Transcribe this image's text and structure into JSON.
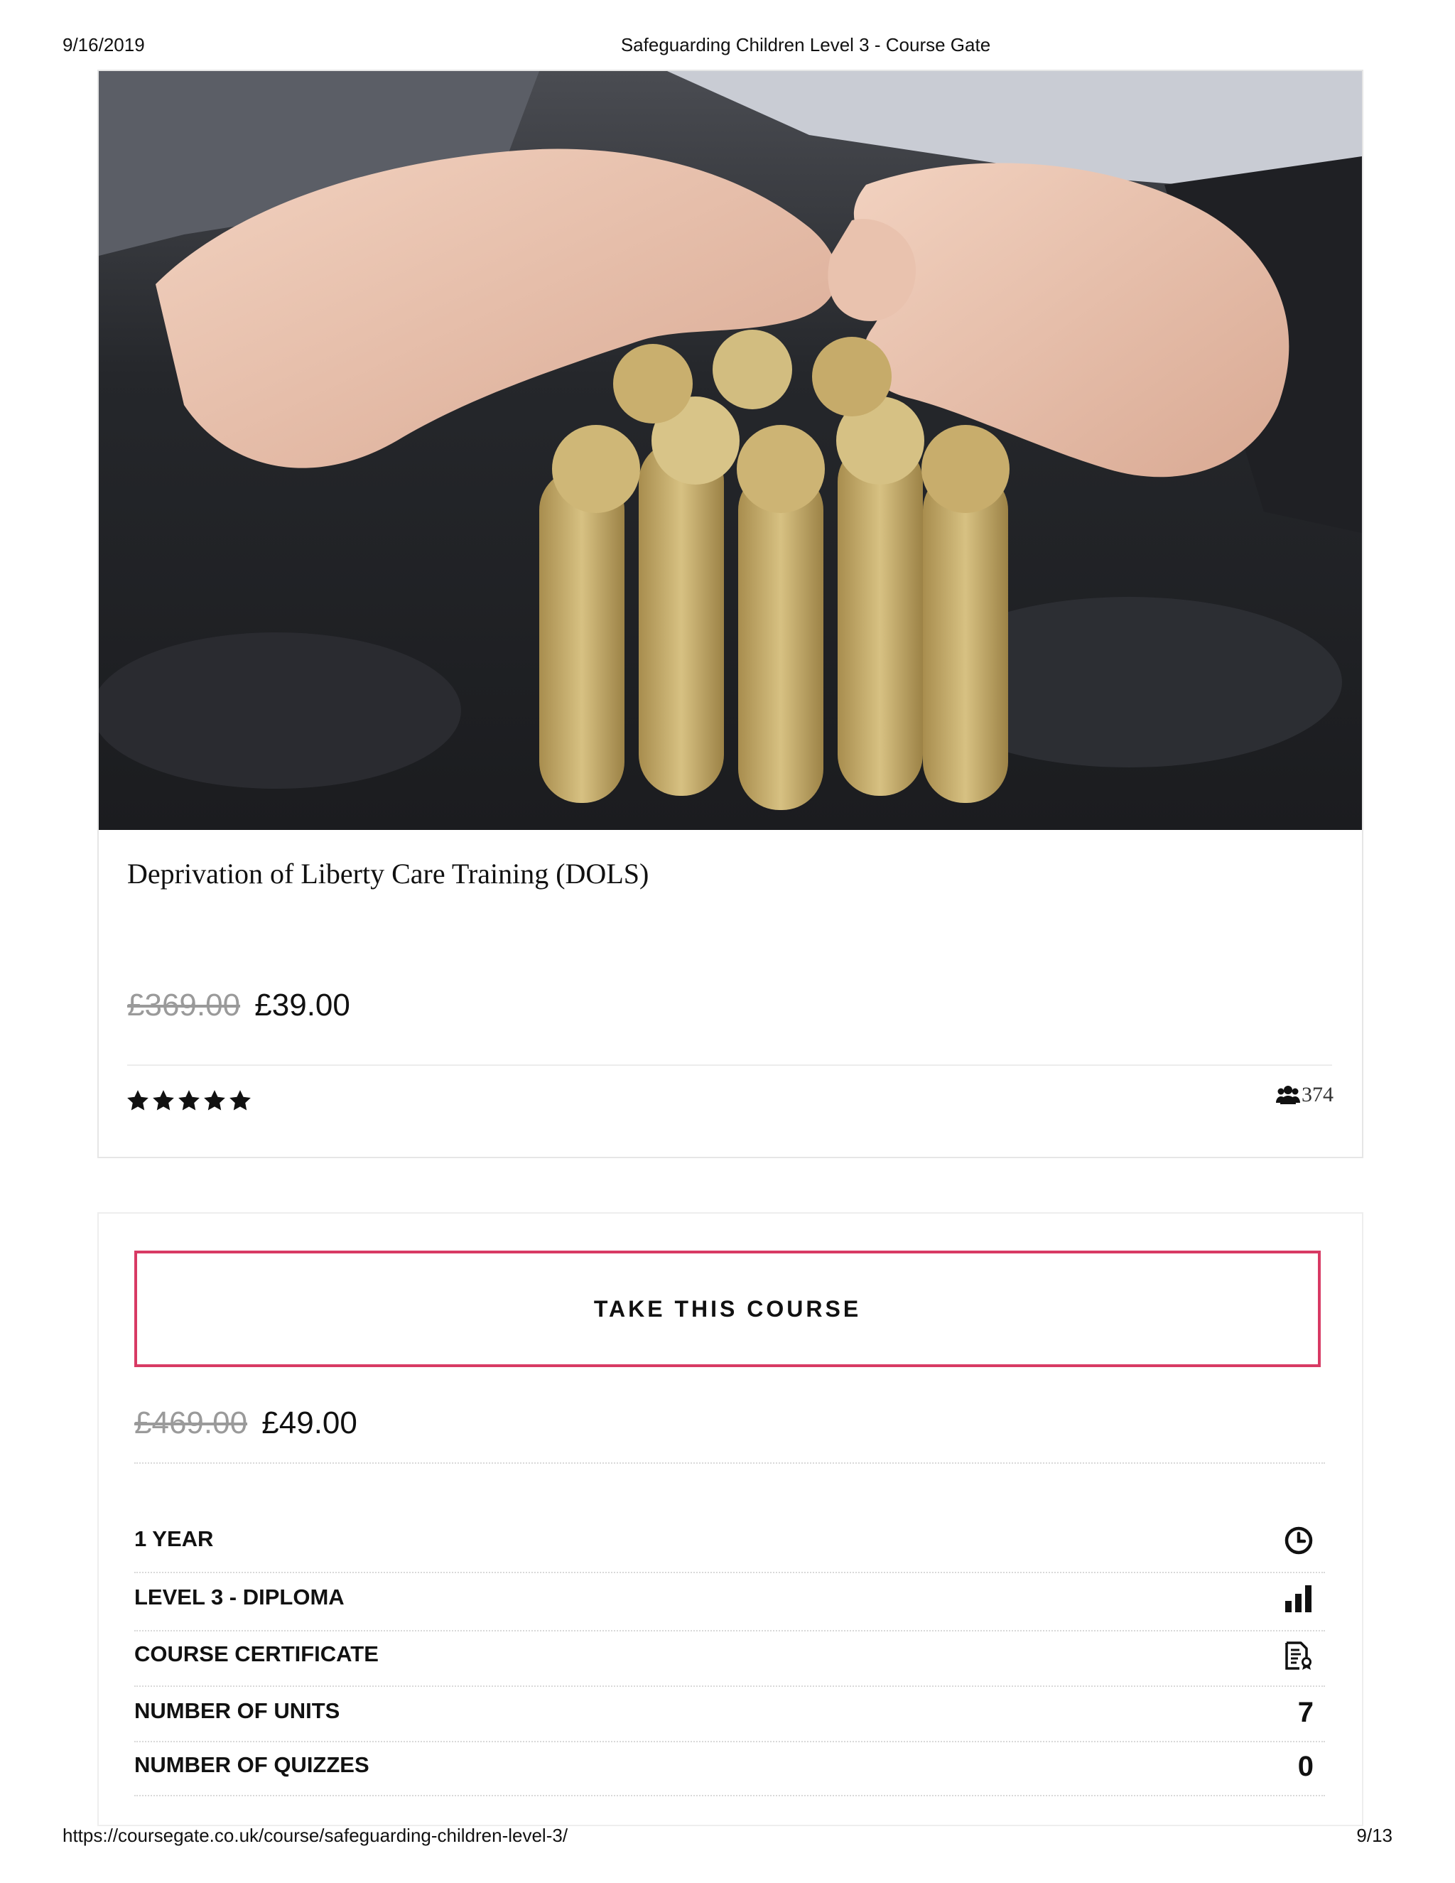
{
  "print_header": {
    "date": "9/16/2019",
    "title": "Safeguarding Children Level 3 - Course Gate"
  },
  "course_card": {
    "title": "Deprivation of Liberty Care Training (DOLS)",
    "old_price": "£369.00",
    "price": "£39.00",
    "rating_stars": 5,
    "students_icon": "users-icon",
    "students_count": "374"
  },
  "purchase_panel": {
    "take_course_label": "TAKE THIS COURSE",
    "old_price": "£469.00",
    "price": "£49.00",
    "accent_color": "#d83a64",
    "details": [
      {
        "label": "1 YEAR",
        "icon": "clock-icon"
      },
      {
        "label": "LEVEL 3 - DIPLOMA",
        "icon": "bar-chart-icon"
      },
      {
        "label": "COURSE CERTIFICATE",
        "icon": "certificate-icon"
      },
      {
        "label": "NUMBER OF UNITS",
        "value": "7"
      },
      {
        "label": "NUMBER OF QUIZZES",
        "value": "0"
      }
    ]
  },
  "print_footer": {
    "url": "https://coursegate.co.uk/course/safeguarding-children-level-3/",
    "page": "9/13"
  }
}
